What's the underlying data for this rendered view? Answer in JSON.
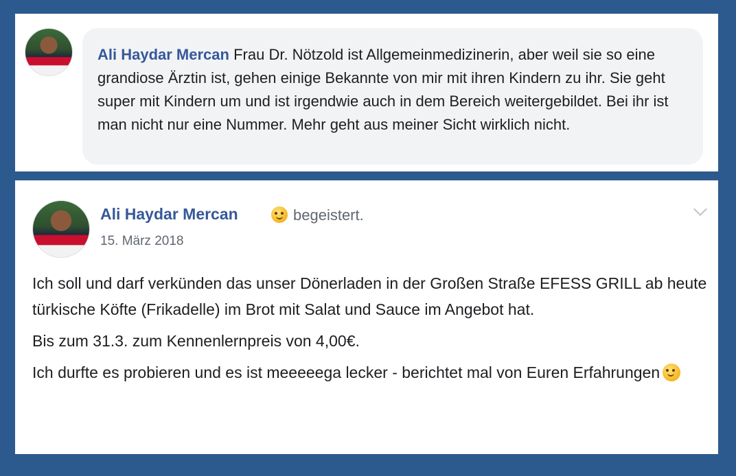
{
  "comment": {
    "author": "Ali Haydar Mercan",
    "text": "Frau Dr. Nötzold ist Allgemeinmedizinerin, aber weil sie so eine grandiose Ärztin ist, gehen einige Bekannte von mir mit ihren Kindern zu ihr. Sie geht super mit Kindern um und ist irgendwie auch in dem Bereich weitergebildet. Bei ihr ist man nicht nur eine Nummer. Mehr geht aus meiner Sicht wirklich nicht."
  },
  "post": {
    "author": "Ali Haydar Mercan",
    "feeling_icon": "slightly-smiling-face-icon",
    "feeling": "begeistert.",
    "date": "15. März 2018",
    "paragraphs": [
      "Ich soll und darf verkünden das unser Dönerladen in der Großen Straße EFESS GRILL ab heute türkische Köfte (Frikadelle) im Brot mit Salat und Sauce im Angebot hat.",
      "Bis zum 31.3. zum Kennenlernpreis von 4,00€.",
      "Ich durfte es probieren und es ist meeeeega lecker - berichtet mal von Euren Erfahrungen"
    ],
    "end_icon": "smiley-icon"
  },
  "colors": {
    "frame": "#2d5a8e",
    "author_link": "#365899",
    "bubble": "#f2f3f5",
    "meta_text": "#606770"
  }
}
